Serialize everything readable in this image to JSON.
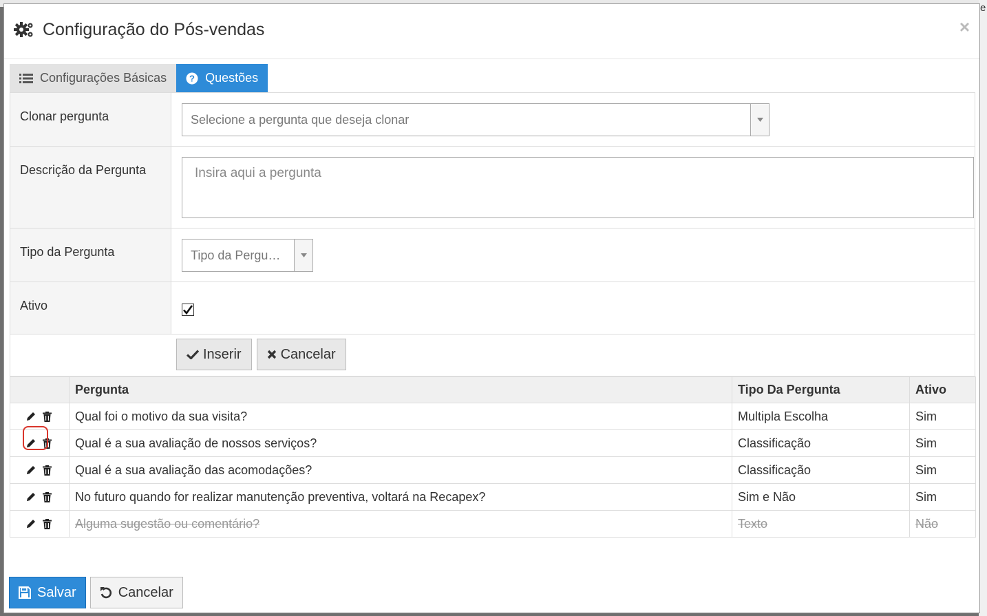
{
  "modal": {
    "title": "Configuração do Pós-vendas",
    "close_label": "×"
  },
  "tabs": [
    {
      "label": "Configurações Básicas",
      "active": false,
      "icon": "list-icon"
    },
    {
      "label": "Questões",
      "active": true,
      "icon": "question-circle-icon"
    }
  ],
  "form": {
    "clone": {
      "label": "Clonar pergunta",
      "placeholder": "Selecione a pergunta que deseja clonar"
    },
    "description": {
      "label": "Descrição da Pergunta",
      "placeholder": "Insira aqui a pergunta"
    },
    "type": {
      "label": "Tipo da Pergunta",
      "placeholder": "Tipo da Pergu…"
    },
    "active": {
      "label": "Ativo",
      "checked": true
    },
    "insert_label": "Inserir",
    "cancel_label": "Cancelar"
  },
  "table": {
    "headers": [
      "",
      "Pergunta",
      "Tipo Da Pergunta",
      "Ativo"
    ],
    "rows": [
      {
        "question": "Qual foi o motivo da sua visita?",
        "type": "Multipla Escolha",
        "active": "Sim",
        "inactive": false
      },
      {
        "question": "Qual é a sua avaliação de nossos serviços?",
        "type": "Classificação",
        "active": "Sim",
        "inactive": false
      },
      {
        "question": "Qual é a sua avaliação das acomodações?",
        "type": "Classificação",
        "active": "Sim",
        "inactive": false
      },
      {
        "question": "No futuro quando for realizar manutenção preventiva, voltará na Recapex?",
        "type": "Sim e Não",
        "active": "Sim",
        "inactive": false
      },
      {
        "question": "Alguma sugestão ou comentário?",
        "type": "Texto",
        "active": "Não",
        "inactive": true
      }
    ]
  },
  "footer": {
    "save_label": "Salvar",
    "cancel_label": "Cancelar"
  },
  "background": {
    "edge_char": "e"
  },
  "colors": {
    "primary": "#2e8bd8",
    "highlight": "#d9352b"
  }
}
